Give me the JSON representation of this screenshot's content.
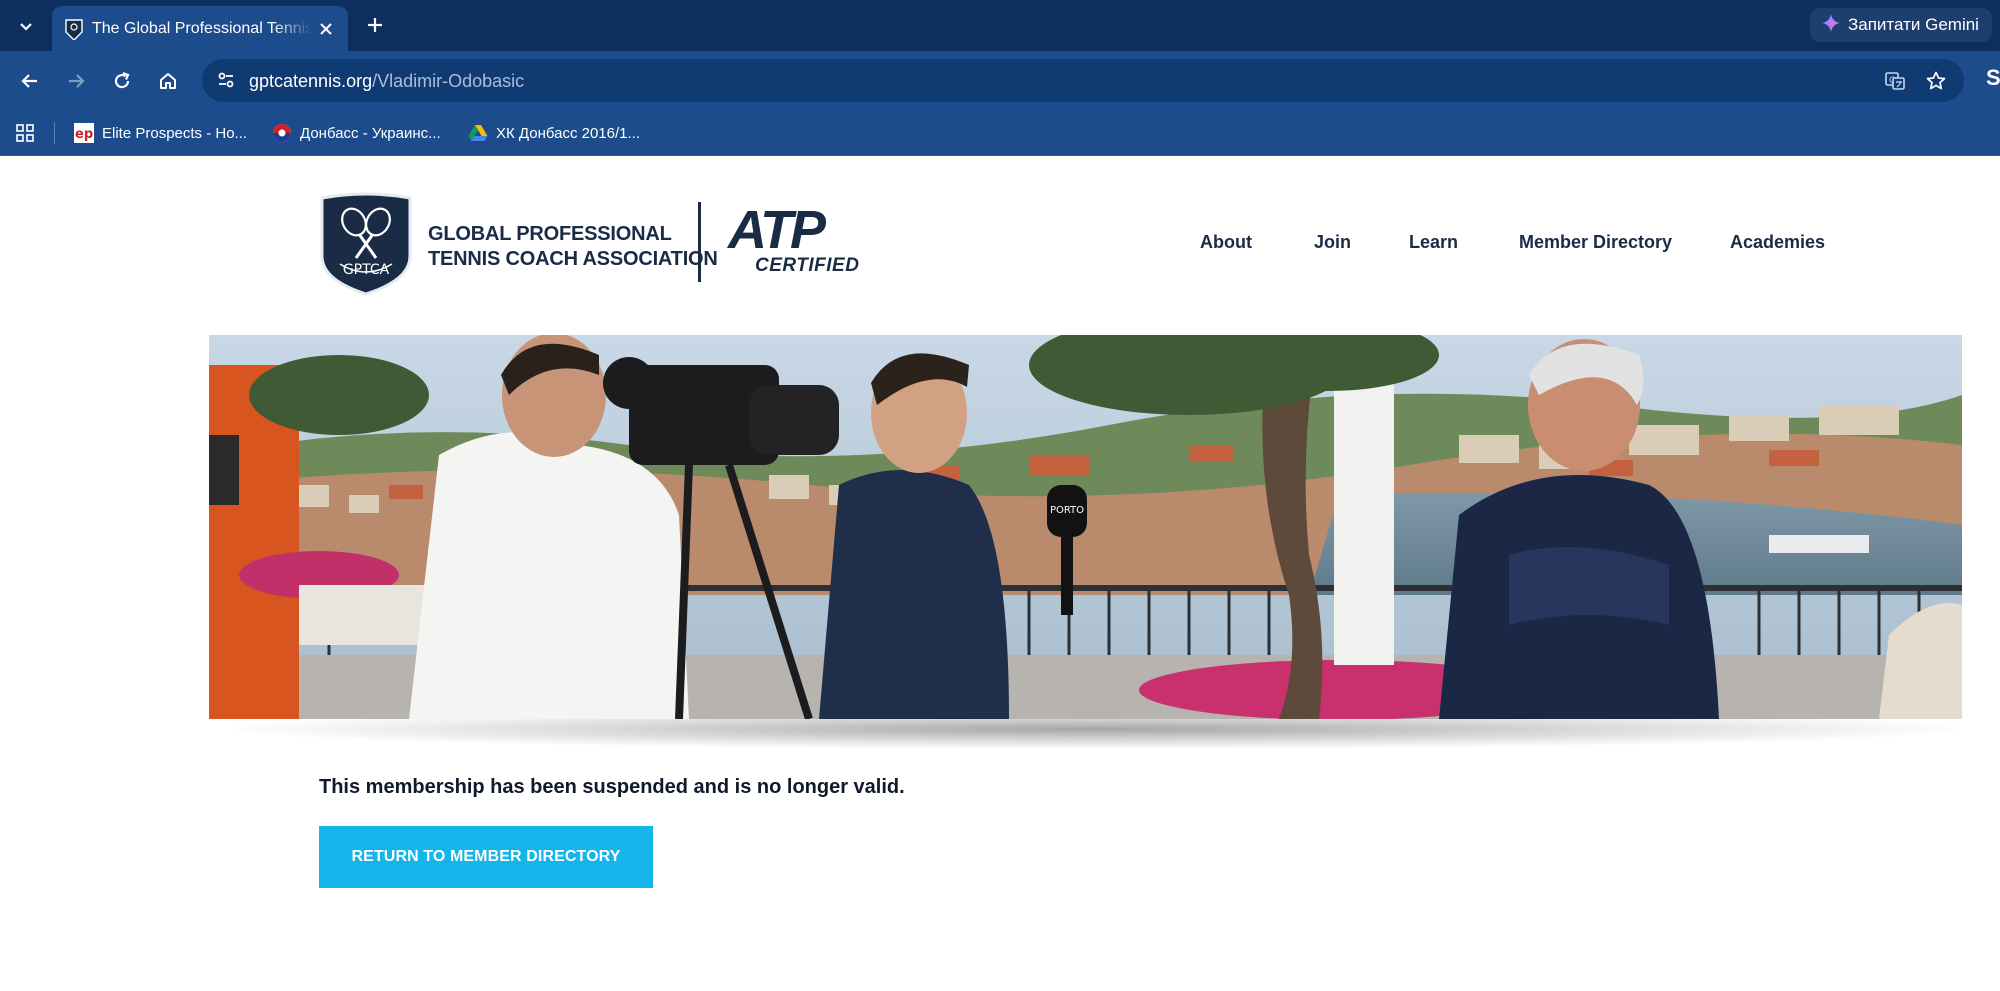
{
  "browser": {
    "tab": {
      "title": "The Global Professional Tennis Coach Association"
    },
    "gemini_label": "Запитати Gemini",
    "address": {
      "host": "gptcatennis.org",
      "path": "/Vladimir-Odobasic"
    },
    "profile_initial": "S",
    "bookmarks": [
      {
        "label": "Elite Prospects - Ho...",
        "icon": "elite-prospects-favicon"
      },
      {
        "label": "Донбасс - Украинс...",
        "icon": "donbass-favicon"
      },
      {
        "label": "ХК Донбасс 2016/1...",
        "icon": "google-drive-favicon"
      }
    ]
  },
  "site": {
    "logo": {
      "badge_text": "GPTCA",
      "line1": "GLOBAL PROFESSIONAL",
      "line2": "TENNIS COACH ASSOCIATION",
      "atp": "ATP",
      "certified": "CERTIFIED"
    },
    "nav": [
      {
        "label": "About"
      },
      {
        "label": "Join"
      },
      {
        "label": "Learn"
      },
      {
        "label": "Member Directory"
      },
      {
        "label": "Academies"
      }
    ],
    "hero": {
      "mic_label": "PORTO"
    },
    "message": "This membership has been suspended and is no longer valid.",
    "return_button": "RETURN TO MEMBER DIRECTORY"
  },
  "colors": {
    "tabbar": "#0c2f5e",
    "toolbar": "#1c4c8c",
    "brand_navy": "#1a2b46",
    "button_cyan": "#13b5ea"
  }
}
